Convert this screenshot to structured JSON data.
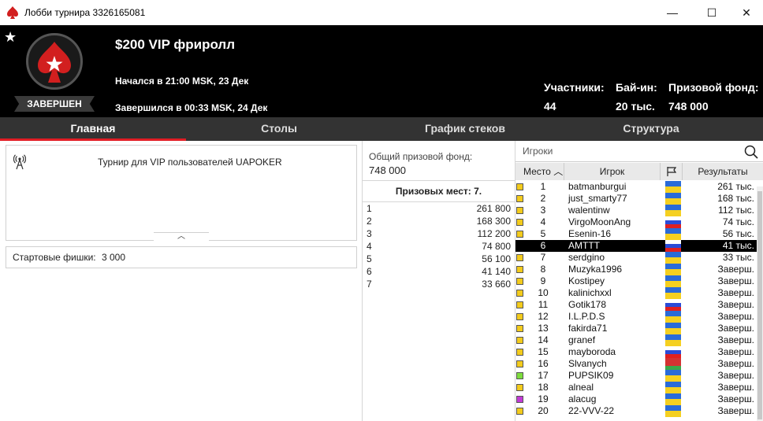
{
  "window": {
    "title": "Лобби турнира 3326165081",
    "minimize": "—",
    "maximize": "☐",
    "close": "✕"
  },
  "header": {
    "name": "$200 VIP фриролл",
    "status": "ЗАВЕРШЕН",
    "started": "Начался в 21:00 MSK, 23 Дек",
    "ended": "Завершился в 00:33 MSK, 24 Дек",
    "stats": [
      {
        "label": "Участники:",
        "value": "44"
      },
      {
        "label": "Бай-ин:",
        "value": "20 тыс."
      },
      {
        "label": "Призовой фонд:",
        "value": "748 000"
      }
    ]
  },
  "tabs": [
    "Главная",
    "Столы",
    "График стеков",
    "Структура"
  ],
  "active_tab": "Главная",
  "info": {
    "description": "Турнир для VIP пользователей UAPOKER",
    "chips_label": "Стартовые фишки:",
    "chips_value": "3 000"
  },
  "prizes": {
    "pool_label": "Общий призовой фонд:",
    "pool_value": "748 000",
    "places_header": "Призовых мест: 7.",
    "rows": [
      {
        "place": "1",
        "amount": "261 800"
      },
      {
        "place": "2",
        "amount": "168 300"
      },
      {
        "place": "3",
        "amount": "112 200"
      },
      {
        "place": "4",
        "amount": "74 800"
      },
      {
        "place": "5",
        "amount": "56 100"
      },
      {
        "place": "6",
        "amount": "41 140"
      },
      {
        "place": "7",
        "amount": "33 660"
      }
    ]
  },
  "players": {
    "search_placeholder": "Игроки",
    "columns": {
      "place": "Место",
      "player": "Игрок",
      "results": "Результаты"
    },
    "colors": {
      "yellow": "#f3cb1c",
      "green": "#7ddc3c",
      "purple": "#c23ad6",
      "ua_top": "#2a6bd8",
      "ua_bottom": "#f5d020",
      "ru_top": "#ffffff",
      "ru_mid": "#2a4bd8",
      "ru_bottom": "#e02020",
      "by_top": "#d43232",
      "by_bottom": "#3aa84a"
    },
    "rows": [
      {
        "rank": "1",
        "name": "batmanburgui",
        "result": "261 тыс.",
        "square": "yellow",
        "flag": "ua"
      },
      {
        "rank": "2",
        "name": "just_smarty77",
        "result": "168 тыс.",
        "square": "yellow",
        "flag": "ua"
      },
      {
        "rank": "3",
        "name": "walentinw",
        "result": "112 тыс.",
        "square": "yellow",
        "flag": "ua"
      },
      {
        "rank": "4",
        "name": "VirgoMoonAng",
        "result": "74 тыс.",
        "square": "yellow",
        "flag": "ru"
      },
      {
        "rank": "5",
        "name": "Esenin-16",
        "result": "56 тыс.",
        "square": "yellow",
        "flag": "ua"
      },
      {
        "rank": "6",
        "name": "AMTTT",
        "result": "41 тыс.",
        "square": "none",
        "flag": "ru",
        "selected": true
      },
      {
        "rank": "7",
        "name": "serdgino",
        "result": "33 тыс.",
        "square": "yellow",
        "flag": "ua"
      },
      {
        "rank": "8",
        "name": "Muzyka1996",
        "result": "Заверш.",
        "square": "yellow",
        "flag": "ua"
      },
      {
        "rank": "9",
        "name": "Kostipey",
        "result": "Заверш.",
        "square": "yellow",
        "flag": "ua"
      },
      {
        "rank": "10",
        "name": "kalinichxxl",
        "result": "Заверш.",
        "square": "yellow",
        "flag": "ua"
      },
      {
        "rank": "11",
        "name": "Gotik178",
        "result": "Заверш.",
        "square": "yellow",
        "flag": "ru"
      },
      {
        "rank": "12",
        "name": "I.L.P.D.S",
        "result": "Заверш.",
        "square": "yellow",
        "flag": "ua"
      },
      {
        "rank": "13",
        "name": "fakirda71",
        "result": "Заверш.",
        "square": "yellow",
        "flag": "ua"
      },
      {
        "rank": "14",
        "name": "granef",
        "result": "Заверш.",
        "square": "yellow",
        "flag": "ua"
      },
      {
        "rank": "15",
        "name": "mayboroda",
        "result": "Заверш.",
        "square": "yellow",
        "flag": "ru"
      },
      {
        "rank": "16",
        "name": "Slvanych",
        "result": "Заверш.",
        "square": "yellow",
        "flag": "by"
      },
      {
        "rank": "17",
        "name": "PUPSIK09",
        "result": "Заверш.",
        "square": "green",
        "flag": "ua"
      },
      {
        "rank": "18",
        "name": "alneal",
        "result": "Заверш.",
        "square": "yellow",
        "flag": "ua"
      },
      {
        "rank": "19",
        "name": "alacug",
        "result": "Заверш.",
        "square": "purple",
        "flag": "ua"
      },
      {
        "rank": "20",
        "name": "22-VVV-22",
        "result": "Заверш.",
        "square": "yellow",
        "flag": "ua"
      }
    ]
  }
}
